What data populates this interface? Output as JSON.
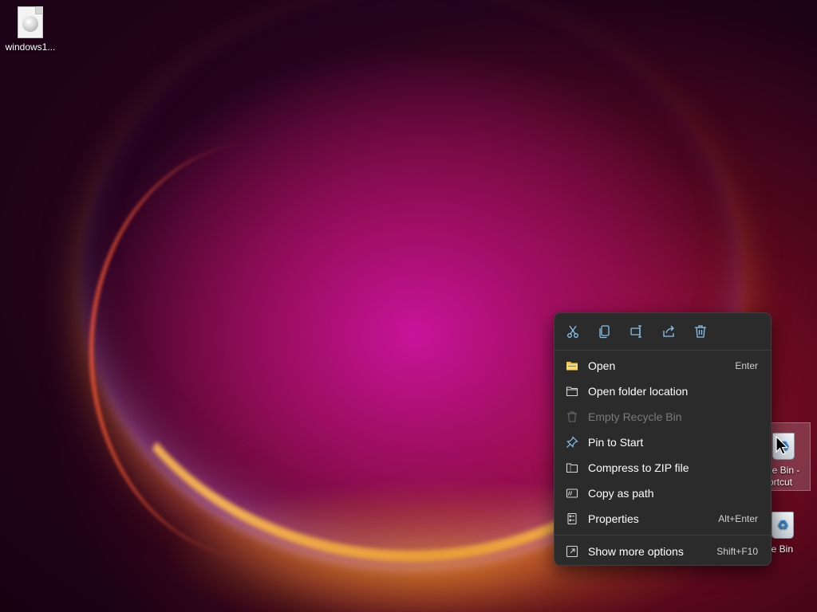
{
  "desktop": {
    "icons": [
      {
        "label": "windows1..."
      },
      {
        "label": "cle Bin -",
        "label2": "ortcut"
      },
      {
        "label": "cle Bin"
      }
    ]
  },
  "context_menu": {
    "toolbar": [
      {
        "icon": "cut-icon"
      },
      {
        "icon": "copy-icon"
      },
      {
        "icon": "rename-icon"
      },
      {
        "icon": "share-icon"
      },
      {
        "icon": "delete-icon"
      }
    ],
    "items": [
      {
        "label": "Open",
        "shortcut": "Enter",
        "icon": "folder-open-icon",
        "enabled": true
      },
      {
        "label": "Open folder location",
        "shortcut": "",
        "icon": "folder-icon",
        "enabled": true
      },
      {
        "label": "Empty Recycle Bin",
        "shortcut": "",
        "icon": "trash-icon",
        "enabled": false
      },
      {
        "label": "Pin to Start",
        "shortcut": "",
        "icon": "pin-icon",
        "enabled": true
      },
      {
        "label": "Compress to ZIP file",
        "shortcut": "",
        "icon": "zip-icon",
        "enabled": true
      },
      {
        "label": "Copy as path",
        "shortcut": "",
        "icon": "path-icon",
        "enabled": true
      },
      {
        "label": "Properties",
        "shortcut": "Alt+Enter",
        "icon": "properties-icon",
        "enabled": true
      },
      {
        "label": "Show more options",
        "shortcut": "Shift+F10",
        "icon": "more-options-icon",
        "enabled": true
      }
    ]
  },
  "colors": {
    "menu_bg": "#2b2b2b",
    "icon_accent": "#8ac4ef",
    "folder_yellow": "#f5c542"
  }
}
